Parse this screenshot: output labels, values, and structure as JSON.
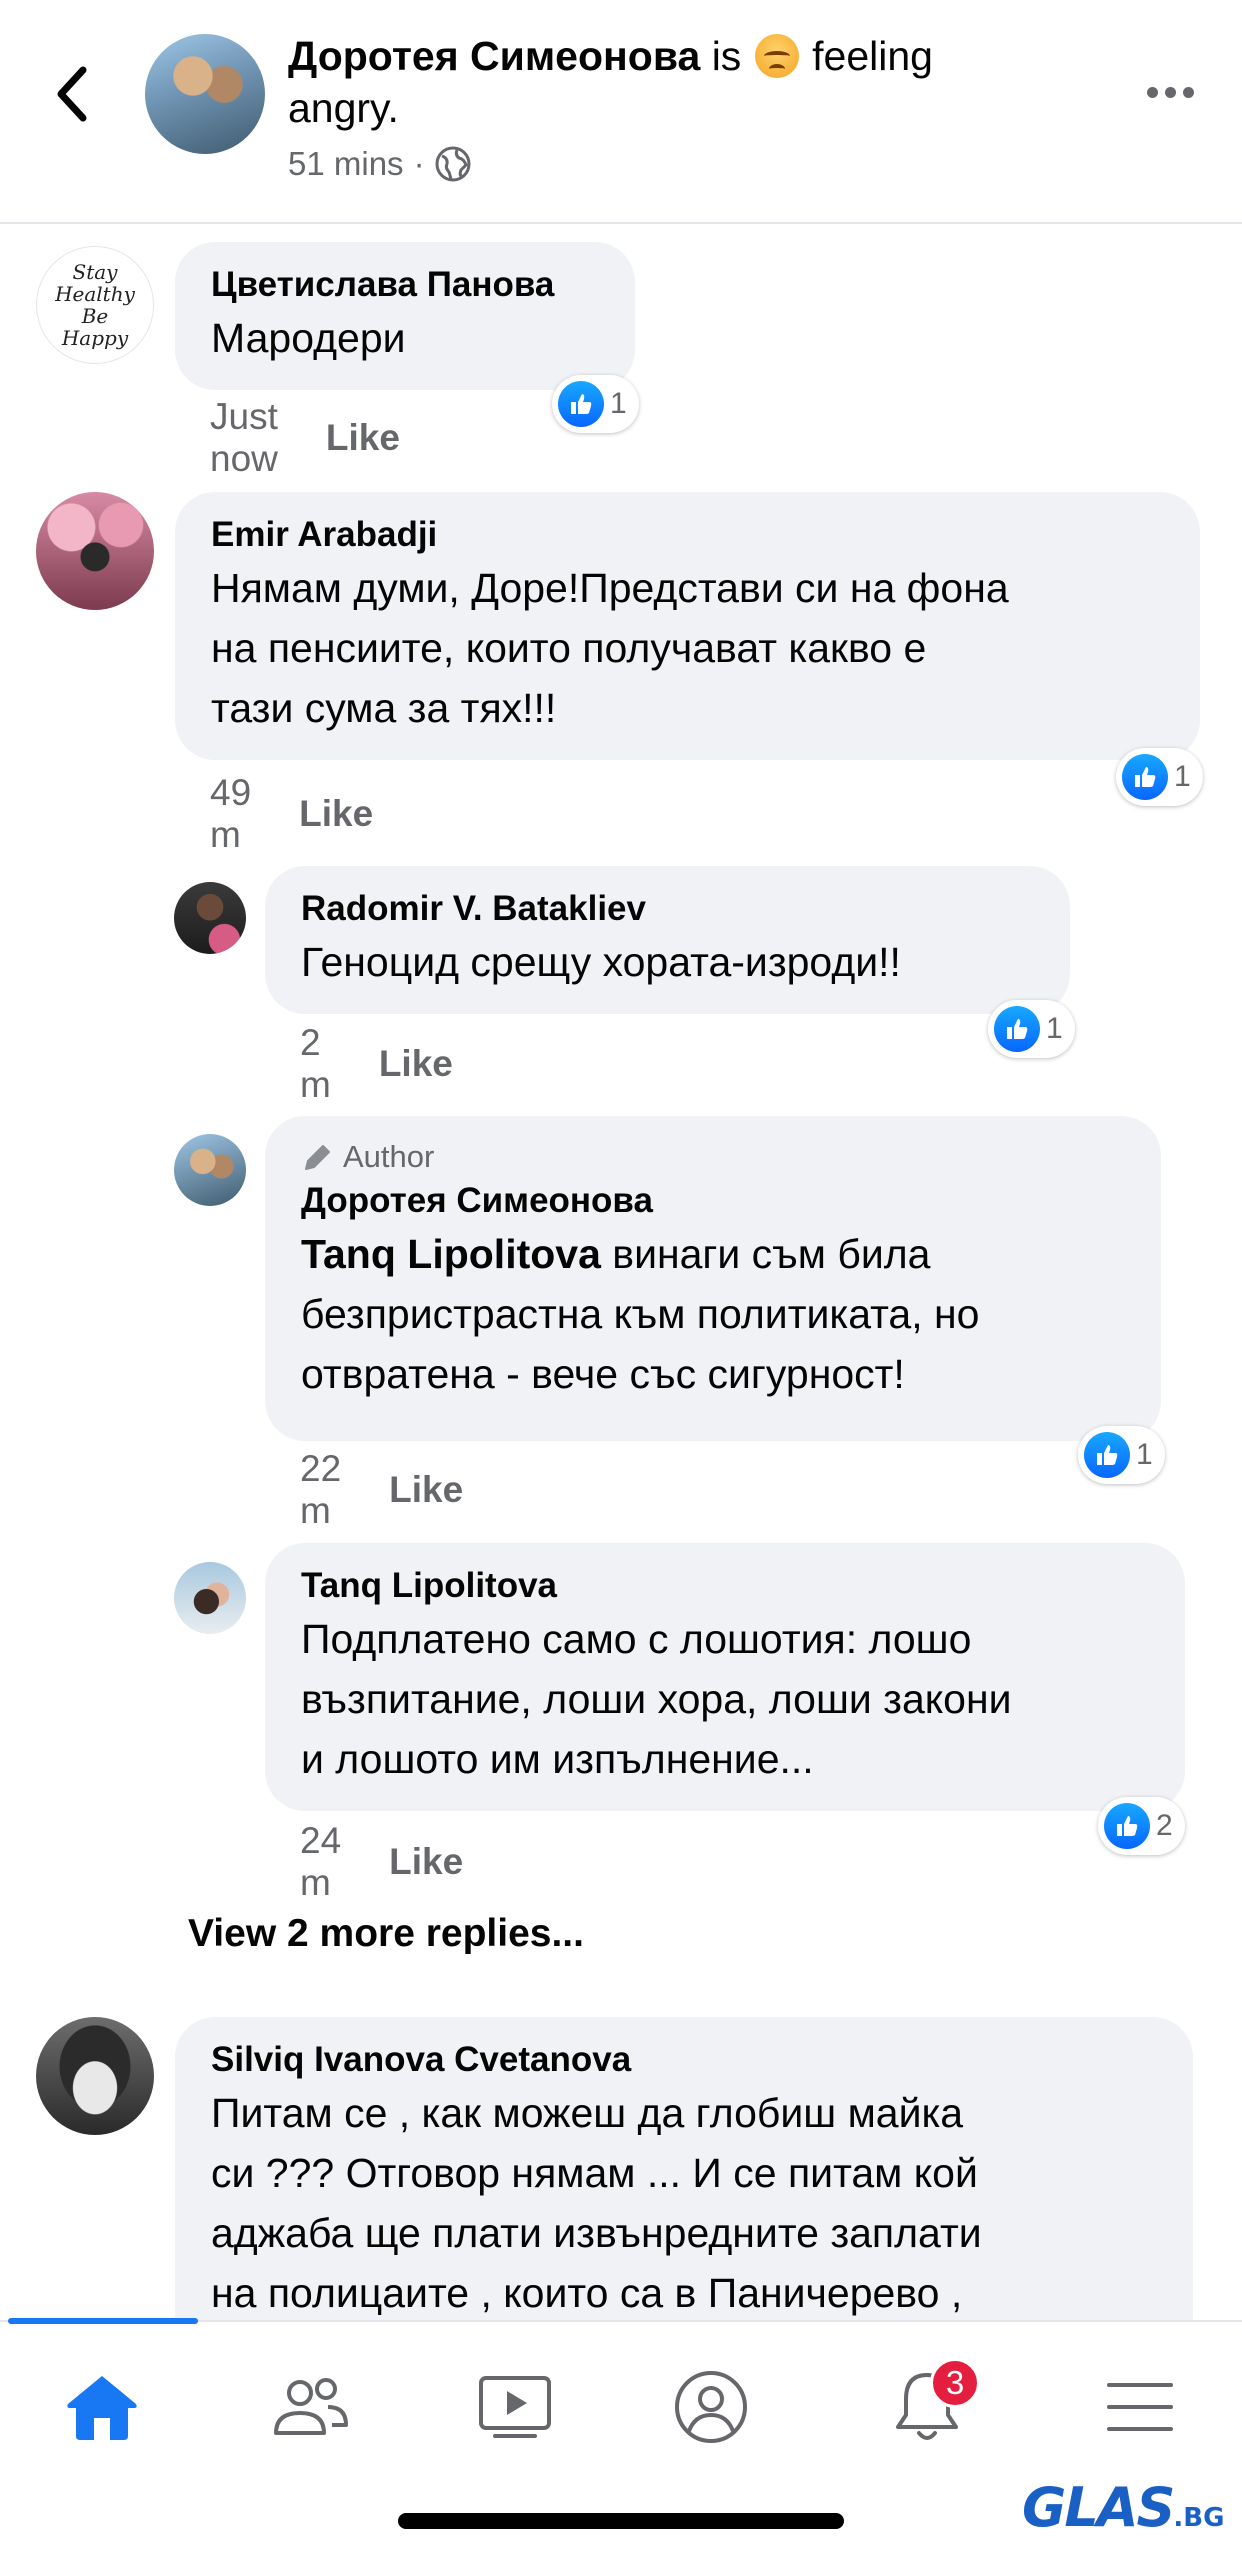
{
  "header": {
    "name": "Доротея Симеонова",
    "is": "is",
    "feeling": "feeling",
    "mood": "angry.",
    "time": "51 mins",
    "dot": "·"
  },
  "comments": [
    {
      "name": "Цветислава Панова",
      "text": "Мародери",
      "time": "Just now",
      "like": "Like",
      "reactions": "1",
      "avatar_text": "Stay Healthy Be Happy"
    },
    {
      "name": "Emir Arabadji",
      "lines": [
        "Нямам думи, Доре!Представи си на фона",
        "на пенсиите, които получават какво е",
        "тази сума за тях!!!"
      ],
      "time": "49 m",
      "like": "Like",
      "reactions": "1"
    },
    {
      "name": "Radomir V. Batakliev",
      "text": "Геноцид срещу хората-изроди!!",
      "time": "2 m",
      "like": "Like",
      "reactions": "1"
    },
    {
      "author_label": "Author",
      "name": "Доротея Симеонова",
      "mention": "Tanq Lipolitova",
      "lines": [
        " винаги съм била",
        "безпристрастна към политиката, но",
        "отвратена - вече със сигурност!"
      ],
      "time": "22 m",
      "like": "Like",
      "reactions": "1"
    },
    {
      "name": "Tanq Lipolitova",
      "lines": [
        "Подплатено само с лошотия: лошо",
        "възпитание, лоши хора, лоши закони",
        "и лошото им изпълнение..."
      ],
      "time": "24 m",
      "like": "Like",
      "reactions": "2"
    },
    {
      "name": "Silviq Ivanova Cvetanova",
      "lines": [
        "Питам се , как можеш да глобиш майка",
        "си ??? Отговор нямам ...  И се питам кой",
        "аджаба ще плати извънредните заплати",
        "на полицаите , които са в Паничерево ,"
      ]
    }
  ],
  "view_more": "View 2 more replies...",
  "tabbar": {
    "notifications_badge": "3",
    "active_tab": "home"
  },
  "watermark": {
    "main": "GLAS",
    "suffix": ".BG"
  },
  "colors": {
    "accent": "#1877f2",
    "bubble": "#f0f2f5",
    "meta": "#65676b",
    "badge": "#e41e3f"
  }
}
